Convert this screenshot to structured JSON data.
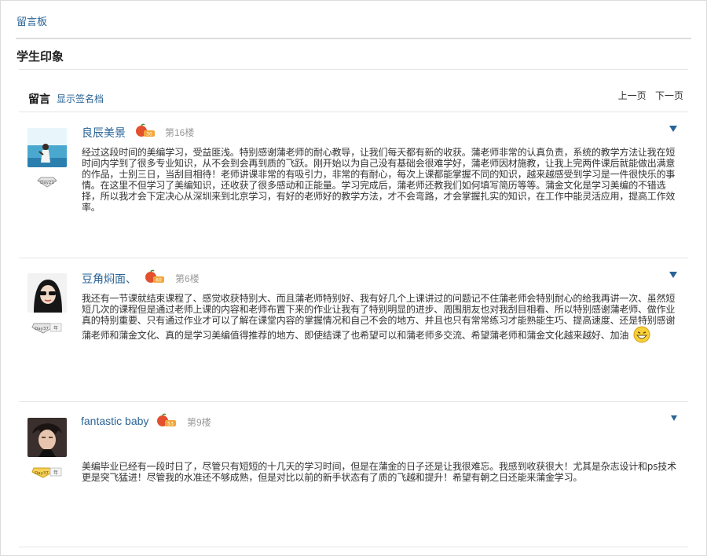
{
  "board": {
    "link_label": "留言板",
    "section_title": "学生印象"
  },
  "header": {
    "title": "留言",
    "show_signature_label": "显示签名档",
    "prev_page": "上一页",
    "next_page": "下一页"
  },
  "posts": [
    {
      "author": "良辰美景",
      "floor": "第16楼",
      "body": "经过这段时间的美编学习，受益匪浅。特别感谢蒲老师的耐心教导，让我们每天都有新的收获。蒲老师非常的认真负责，系统的教学方法让我在短时间内学到了很多专业知识，从不会到会再到质的飞跃。刚开始以为自己没有基础会很难学好，蒲老师因材施教，让我上完两件课后就能做出满意的作品，士别三日，当刮目相待！老师讲课非常的有吸引力，非常的有耐心，每次上课都能掌握不同的知识，越来越感受到学习是一件很快乐的事情。在这里不但学习了美编知识，还收获了很多感动和正能量。学习完成后，蒲老师还教我们如何填写简历等等。蒲金文化是学习美编的不错选择，所以我才会下定决心从深圳来到北京学习，有好的老师好的教学方法，才不会弯路，才会掌握扎实的知识，在工作中能灵活应用，提高工作效率。"
    },
    {
      "author": "豆角焖面、",
      "floor": "第6楼",
      "body": "我还有一节课就结束课程了、感觉收获特别大、而且蒲老师特别好、我有好几个上课讲过的问题记不住蒲老师会特别耐心的给我再讲一次、虽然短短几次的课程但是通过老师上课的内容和老师布置下来的作业让我有了特别明显的进步、周围朋友也对我刮目相看、所以特别感谢蒲老师、做作业真的特别重要、只有通过作业才可以了解在课堂内容的掌握情况和自己不会的地方、并且也只有常常练习才能熟能生巧、提高速度、还是特别感谢蒲老师和蒲金文化、真的是学习美编值得推荐的地方、即使结课了也希望可以和蒲老师多交流、希望蒲老师和蒲金文化越来越好、加油"
    },
    {
      "author": "fantastic baby",
      "floor": "第9楼",
      "body": "美编毕业已经有一段时日了，尽管只有短短的十几天的学习时间，但是在蒲金的日子还是让我很难忘。我感到收获很大！尤其是杂志设计和ps技术更是突飞猛进！尽管我的水准还不够成熟，但是对比以前的新手状态有了质的飞越和提升！希望有朝之日还能来蒲金学习。"
    }
  ],
  "badges": [
    "Day21",
    "Day37 年",
    "Day37 年"
  ],
  "level_marks": [
    "30",
    "60",
    "53"
  ],
  "icons": [
    "avatar-beach-photo",
    "avatar-sunglasses-photo",
    "avatar-portrait-photo",
    "diamond-badge-icon",
    "fruit-level-icon",
    "expand-arrow-icon",
    "laughing-emoji-icon"
  ],
  "colors": {
    "link": "#2a6496",
    "divider": "#e5e5e5",
    "muted": "#999999",
    "text": "#333333"
  }
}
